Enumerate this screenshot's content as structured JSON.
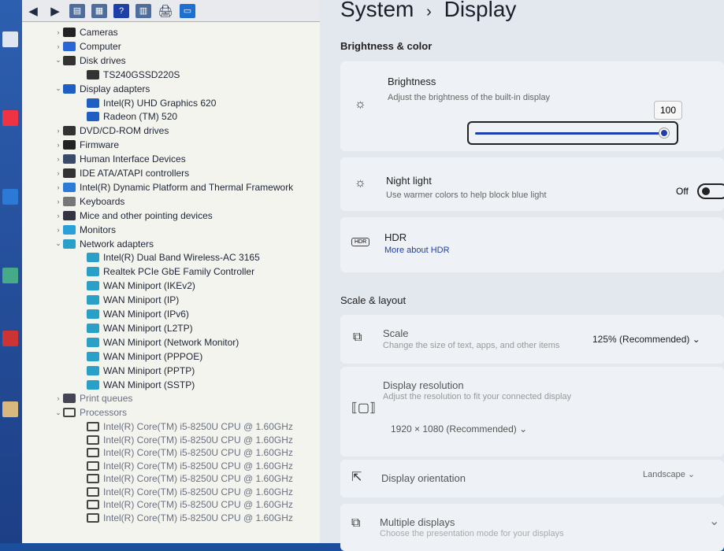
{
  "device_manager": {
    "toolbar": [
      "back",
      "forward",
      "properties",
      "update-driver",
      "help",
      "view",
      "scan",
      "monitor"
    ],
    "tree": [
      {
        "label": "Cameras",
        "level": 0,
        "state": "collapsed",
        "icon": "camera",
        "color": "#222"
      },
      {
        "label": "Computer",
        "level": 0,
        "state": "collapsed",
        "icon": "computer",
        "color": "#2a66d6"
      },
      {
        "label": "Disk drives",
        "level": 0,
        "state": "expanded",
        "icon": "disk",
        "color": "#333"
      },
      {
        "label": "TS240GSSD220S",
        "level": 1,
        "icon": "disk",
        "color": "#333"
      },
      {
        "label": "Display adapters",
        "level": 0,
        "state": "expanded",
        "icon": "display",
        "color": "#1f5fc4"
      },
      {
        "label": "Intel(R) UHD Graphics 620",
        "level": 1,
        "icon": "display",
        "color": "#1f5fc4"
      },
      {
        "label": "Radeon (TM) 520",
        "level": 1,
        "icon": "display",
        "color": "#1f5fc4"
      },
      {
        "label": "DVD/CD-ROM drives",
        "level": 0,
        "state": "collapsed",
        "icon": "dvd",
        "color": "#333"
      },
      {
        "label": "Firmware",
        "level": 0,
        "state": "collapsed",
        "icon": "firmware",
        "color": "#222"
      },
      {
        "label": "Human Interface Devices",
        "level": 0,
        "state": "collapsed",
        "icon": "hid",
        "color": "#3a4a6a"
      },
      {
        "label": "IDE ATA/ATAPI controllers",
        "level": 0,
        "state": "collapsed",
        "icon": "ide",
        "color": "#333"
      },
      {
        "label": "Intel(R) Dynamic Platform and Thermal Framework",
        "level": 0,
        "state": "collapsed",
        "icon": "folder",
        "color": "#2b7bd6"
      },
      {
        "label": "Keyboards",
        "level": 0,
        "state": "collapsed",
        "icon": "keyboard",
        "color": "#777"
      },
      {
        "label": "Mice and other pointing devices",
        "level": 0,
        "state": "collapsed",
        "icon": "mouse",
        "color": "#334"
      },
      {
        "label": "Monitors",
        "level": 0,
        "state": "collapsed",
        "icon": "monitor",
        "color": "#2aa0d8"
      },
      {
        "label": "Network adapters",
        "level": 0,
        "state": "expanded",
        "icon": "network",
        "color": "#2aa0c8"
      },
      {
        "label": "Intel(R) Dual Band Wireless-AC 3165",
        "level": 1,
        "icon": "network",
        "color": "#2aa0c8"
      },
      {
        "label": "Realtek PCIe GbE Family Controller",
        "level": 1,
        "icon": "network",
        "color": "#2aa0c8"
      },
      {
        "label": "WAN Miniport (IKEv2)",
        "level": 1,
        "icon": "network",
        "color": "#2aa0c8"
      },
      {
        "label": "WAN Miniport (IP)",
        "level": 1,
        "icon": "network",
        "color": "#2aa0c8"
      },
      {
        "label": "WAN Miniport (IPv6)",
        "level": 1,
        "icon": "network",
        "color": "#2aa0c8"
      },
      {
        "label": "WAN Miniport (L2TP)",
        "level": 1,
        "icon": "network",
        "color": "#2aa0c8"
      },
      {
        "label": "WAN Miniport (Network Monitor)",
        "level": 1,
        "icon": "network",
        "color": "#2aa0c8"
      },
      {
        "label": "WAN Miniport (PPPOE)",
        "level": 1,
        "icon": "network",
        "color": "#2aa0c8"
      },
      {
        "label": "WAN Miniport (PPTP)",
        "level": 1,
        "icon": "network",
        "color": "#2aa0c8"
      },
      {
        "label": "WAN Miniport (SSTP)",
        "level": 1,
        "icon": "network",
        "color": "#2aa0c8"
      },
      {
        "label": "Print queues",
        "level": 0,
        "state": "collapsed",
        "icon": "printer",
        "color": "#445"
      },
      {
        "label": "Processors",
        "level": 0,
        "state": "expanded",
        "icon": "processor",
        "color": "#444"
      },
      {
        "label": "Intel(R) Core(TM) i5-8250U CPU @ 1.60GHz",
        "level": 1,
        "icon": "processor",
        "color": "#444"
      },
      {
        "label": "Intel(R) Core(TM) i5-8250U CPU @ 1.60GHz",
        "level": 1,
        "icon": "processor",
        "color": "#444"
      },
      {
        "label": "Intel(R) Core(TM) i5-8250U CPU @ 1.60GHz",
        "level": 1,
        "icon": "processor",
        "color": "#444"
      },
      {
        "label": "Intel(R) Core(TM) i5-8250U CPU @ 1.60GHz",
        "level": 1,
        "icon": "processor",
        "color": "#444"
      },
      {
        "label": "Intel(R) Core(TM) i5-8250U CPU @ 1.60GHz",
        "level": 1,
        "icon": "processor",
        "color": "#444"
      },
      {
        "label": "Intel(R) Core(TM) i5-8250U CPU @ 1.60GHz",
        "level": 1,
        "icon": "processor",
        "color": "#444"
      },
      {
        "label": "Intel(R) Core(TM) i5-8250U CPU @ 1.60GHz",
        "level": 1,
        "icon": "processor",
        "color": "#444"
      },
      {
        "label": "Intel(R) Core(TM) i5-8250U CPU @ 1.60GHz",
        "level": 1,
        "icon": "processor",
        "color": "#444"
      }
    ]
  },
  "settings": {
    "breadcrumb": {
      "parent": "System",
      "sep": "›",
      "current": "Display"
    },
    "brightness_color": {
      "heading": "Brightness & color",
      "brightness": {
        "title": "Brightness",
        "desc": "Adjust the brightness of the built-in display",
        "value": "100",
        "percent": 100
      },
      "night_light": {
        "title": "Night light",
        "desc": "Use warmer colors to help block blue light",
        "state": "Off"
      },
      "hdr": {
        "title": "HDR",
        "link": "More about HDR",
        "icon_text": "HDR"
      }
    },
    "scale_layout": {
      "heading": "Scale & layout",
      "scale": {
        "title": "Scale",
        "desc": "Change the size of text, apps, and other items",
        "value": "125% (Recommended)"
      },
      "resolution": {
        "title": "Display resolution",
        "desc": "Adjust the resolution to fit your connected display",
        "value": "1920 × 1080 (Recommended)"
      },
      "orientation": {
        "title": "Display orientation",
        "value": "Landscape"
      },
      "multiple": {
        "title": "Multiple displays",
        "desc": "Choose the presentation mode for your displays"
      }
    }
  },
  "colors": {
    "accent": "#1f3fb0",
    "desktop": "#1b4f9c"
  }
}
